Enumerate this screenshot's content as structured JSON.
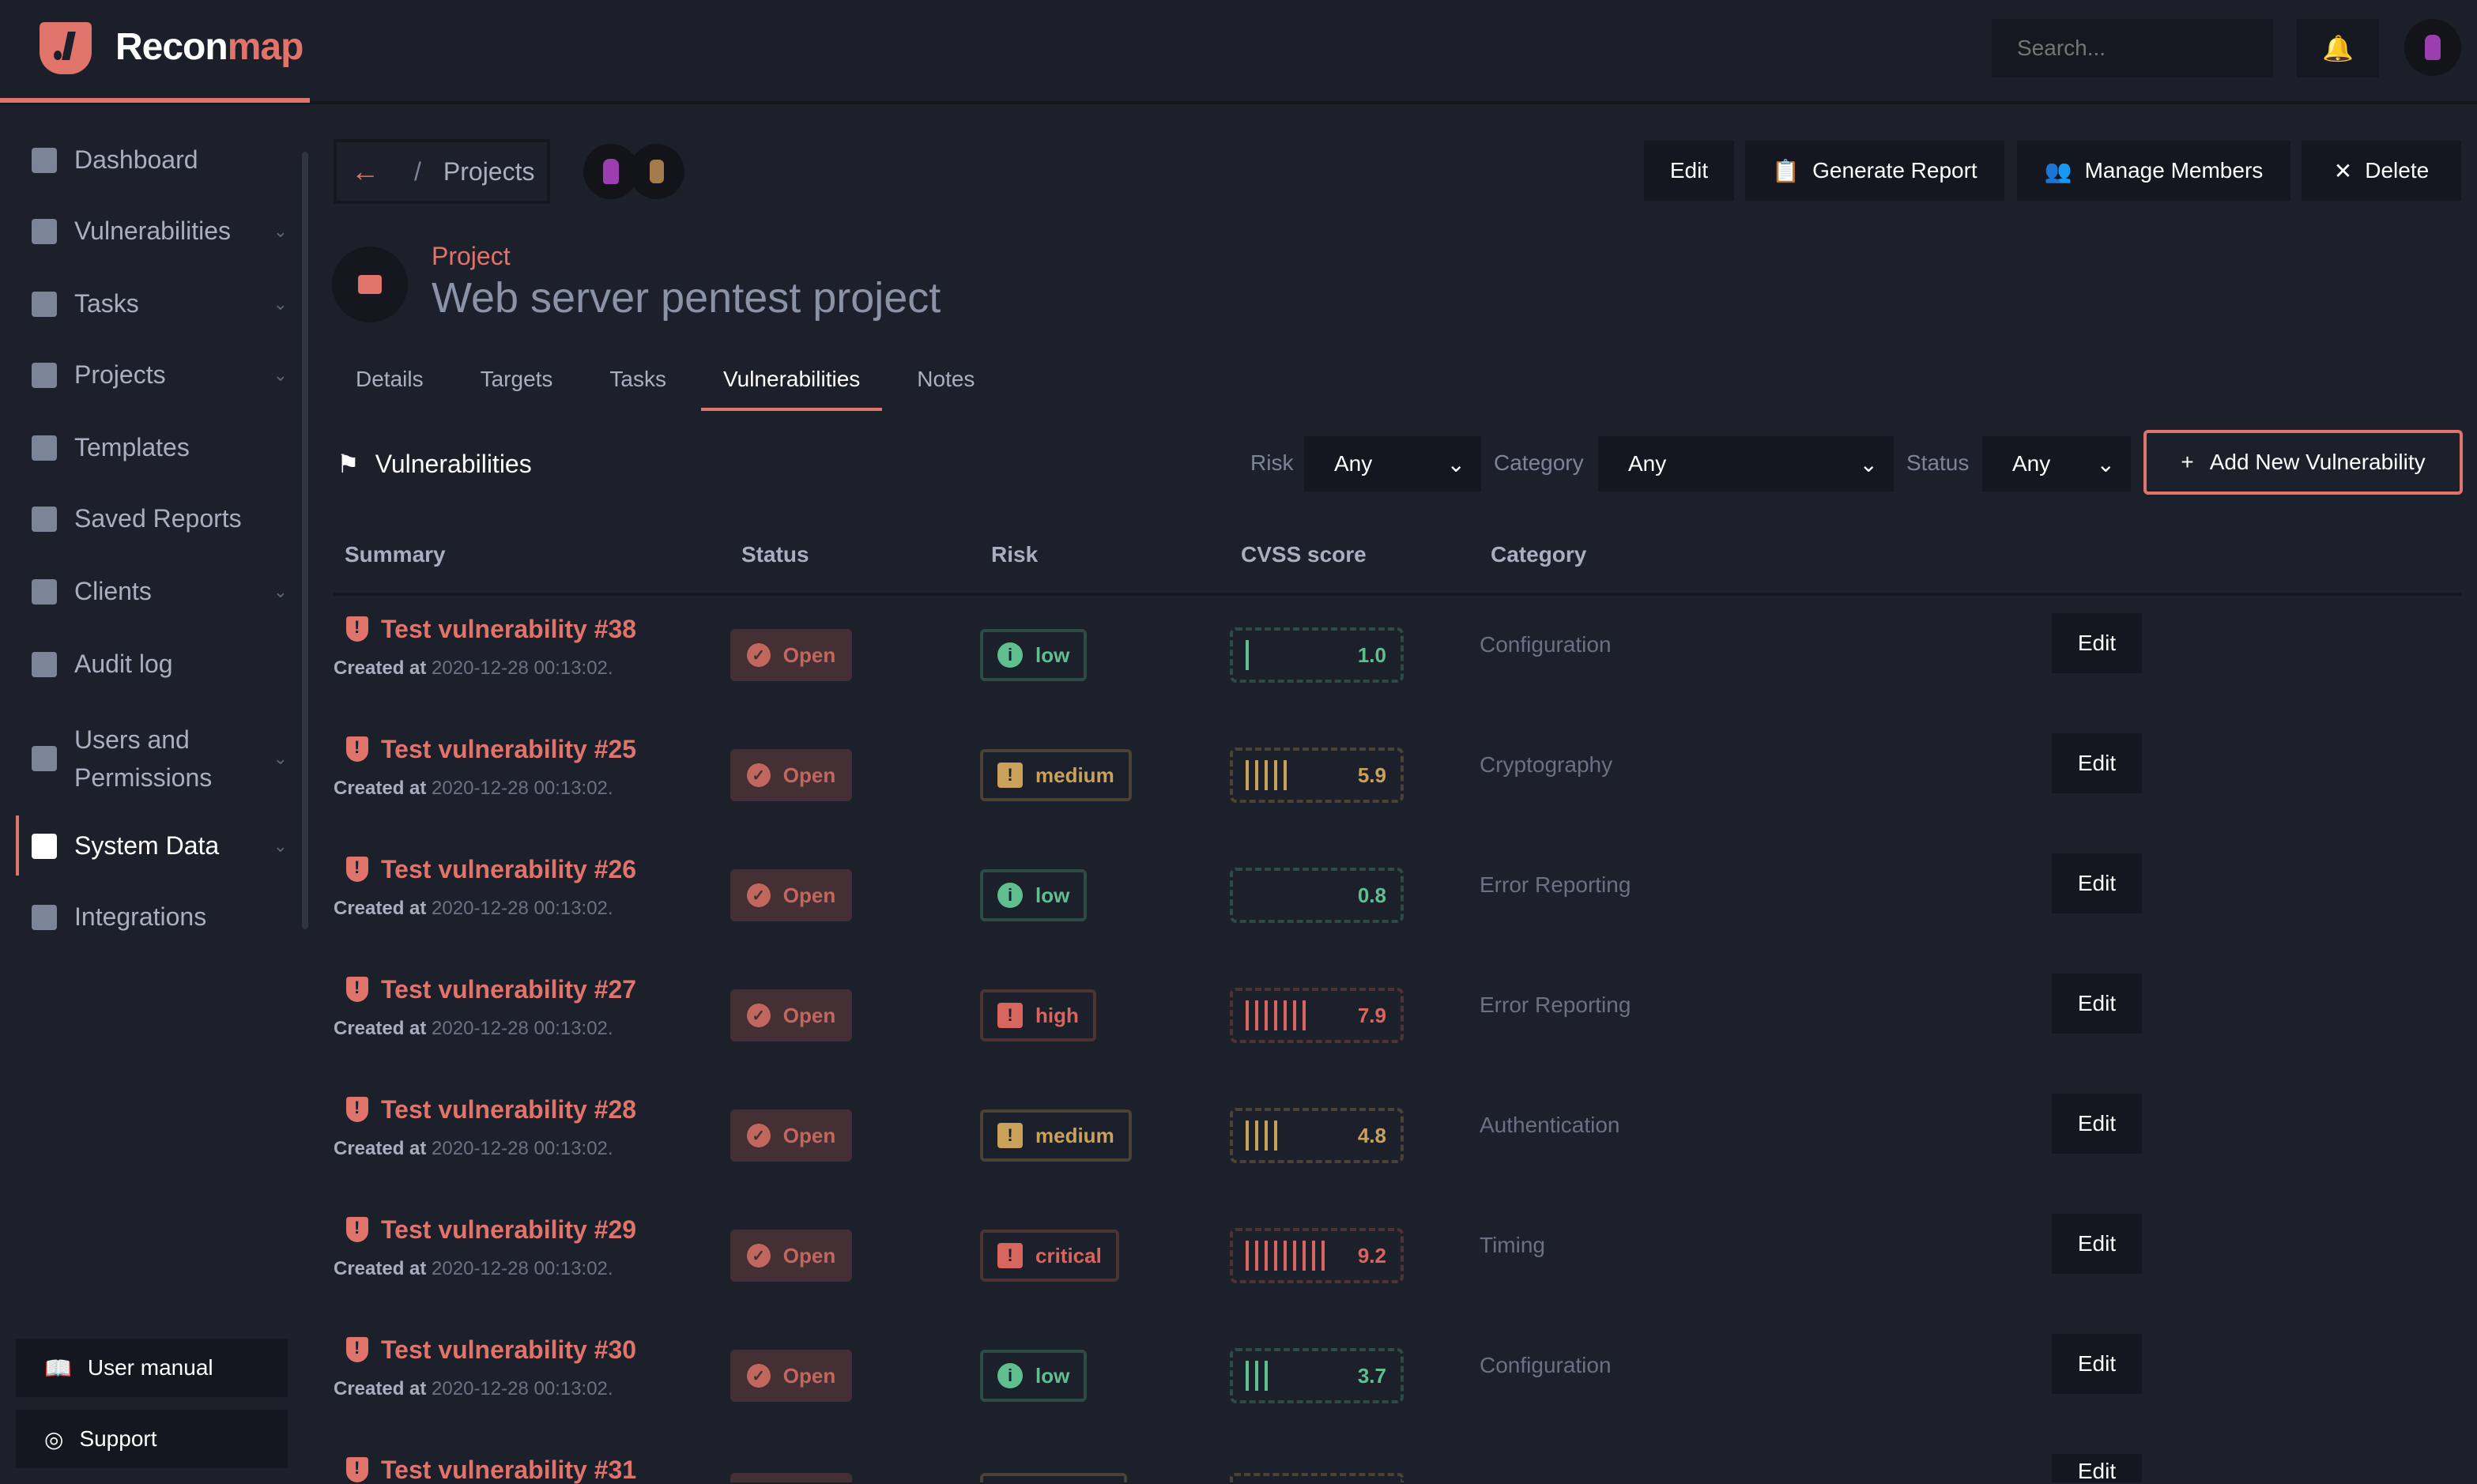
{
  "app": {
    "brand_a": "Recon",
    "brand_b": "map",
    "search_placeholder": "Search..."
  },
  "colors": {
    "accent": "#e0736a",
    "low": "#5fbf8f",
    "medium": "#c9a15a",
    "high": "#d9665e",
    "critical": "#d9665e"
  },
  "sidebar": {
    "items": [
      {
        "label": "Dashboard",
        "icon": "dashboard-icon",
        "chev": false
      },
      {
        "label": "Vulnerabilities",
        "icon": "flag-icon",
        "chev": true
      },
      {
        "label": "Tasks",
        "icon": "clipboard-icon",
        "chev": true
      },
      {
        "label": "Projects",
        "icon": "folder-icon",
        "chev": true
      },
      {
        "label": "Templates",
        "icon": "copy-icon",
        "chev": false
      },
      {
        "label": "Saved Reports",
        "icon": "report-icon",
        "chev": false
      },
      {
        "label": "Clients",
        "icon": "briefcase-icon",
        "chev": true
      },
      {
        "label": "Audit log",
        "icon": "eye-icon",
        "chev": false
      },
      {
        "label": "Users and Permissions",
        "icon": "users-icon",
        "chev": true
      },
      {
        "label": "System Data",
        "icon": "database-icon",
        "chev": true,
        "active": true
      },
      {
        "label": "Integrations",
        "icon": "puzzle-icon",
        "chev": false
      }
    ],
    "user_manual": "User manual",
    "support": "Support"
  },
  "breadcrumb": {
    "sep": "/",
    "label": "Projects"
  },
  "toolbar": {
    "edit": "Edit",
    "generate_report": "Generate Report",
    "manage_members": "Manage Members",
    "delete": "Delete"
  },
  "project": {
    "label": "Project",
    "title": "Web server pentest project"
  },
  "tabs": [
    "Details",
    "Targets",
    "Tasks",
    "Vulnerabilities",
    "Notes"
  ],
  "active_tab": "Vulnerabilities",
  "section": {
    "title": "Vulnerabilities",
    "risk_label": "Risk",
    "risk_value": "Any",
    "category_label": "Category",
    "category_value": "Any",
    "status_label": "Status",
    "status_value": "Any",
    "add_button": "Add New Vulnerability"
  },
  "table": {
    "headers": [
      "Summary",
      "Status",
      "Risk",
      "CVSS score",
      "Category"
    ],
    "created_label": "Created at",
    "edit_label": "Edit",
    "rows": [
      {
        "title": "Test vulnerability #38",
        "created": "2020-12-28 00:13:02.",
        "status": "Open",
        "risk": "low",
        "cvss": "1.0",
        "category": "Configuration"
      },
      {
        "title": "Test vulnerability #25",
        "created": "2020-12-28 00:13:02.",
        "status": "Open",
        "risk": "medium",
        "cvss": "5.9",
        "category": "Cryptography"
      },
      {
        "title": "Test vulnerability #26",
        "created": "2020-12-28 00:13:02.",
        "status": "Open",
        "risk": "low",
        "cvss": "0.8",
        "category": "Error Reporting"
      },
      {
        "title": "Test vulnerability #27",
        "created": "2020-12-28 00:13:02.",
        "status": "Open",
        "risk": "high",
        "cvss": "7.9",
        "category": "Error Reporting"
      },
      {
        "title": "Test vulnerability #28",
        "created": "2020-12-28 00:13:02.",
        "status": "Open",
        "risk": "medium",
        "cvss": "4.8",
        "category": "Authentication"
      },
      {
        "title": "Test vulnerability #29",
        "created": "2020-12-28 00:13:02.",
        "status": "Open",
        "risk": "critical",
        "cvss": "9.2",
        "category": "Timing"
      },
      {
        "title": "Test vulnerability #30",
        "created": "2020-12-28 00:13:02.",
        "status": "Open",
        "risk": "low",
        "cvss": "3.7",
        "category": "Configuration"
      },
      {
        "title": "Test vulnerability #31"
      }
    ]
  }
}
